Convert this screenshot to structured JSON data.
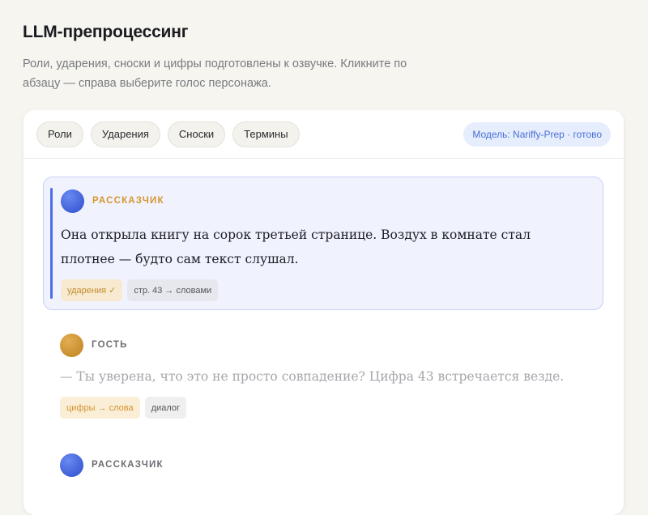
{
  "header": {
    "title": "LLM-препроцессинг",
    "subtitle": "Роли, ударения, сноски и цифры подготовлены к озвучке. Кликните по абзацу — справа выберите голос персонажа."
  },
  "toolbar": {
    "chips": [
      "Роли",
      "Ударения",
      "Сноски",
      "Термины"
    ],
    "status": "Модель: Nariffy-Prep · готово"
  },
  "paragraphs": [
    {
      "speaker": "РАССКАЗЧИК",
      "avatar": "blue",
      "active": true,
      "text": "Она открыла книгу на сорок третьей странице. Воздух в комнате стал плотнее — будто сам текст слушал.",
      "tags": [
        "ударения ✓",
        "стр. 43 → словами"
      ]
    },
    {
      "speaker": "ГОСТЬ",
      "avatar": "gold",
      "active": false,
      "text": "— Ты уверена, что это не просто совпадение? Цифра 43 встречается везде.",
      "tags": [
        "цифры → слова",
        "диалог"
      ]
    },
    {
      "speaker": "РАССКАЗЧИК",
      "avatar": "blue",
      "active": false
    }
  ],
  "colors": {
    "accent": "#4d6ee5",
    "narrator": "#d6962f",
    "status_bg": "#e6edfc",
    "status_text": "#4a6fd6"
  }
}
